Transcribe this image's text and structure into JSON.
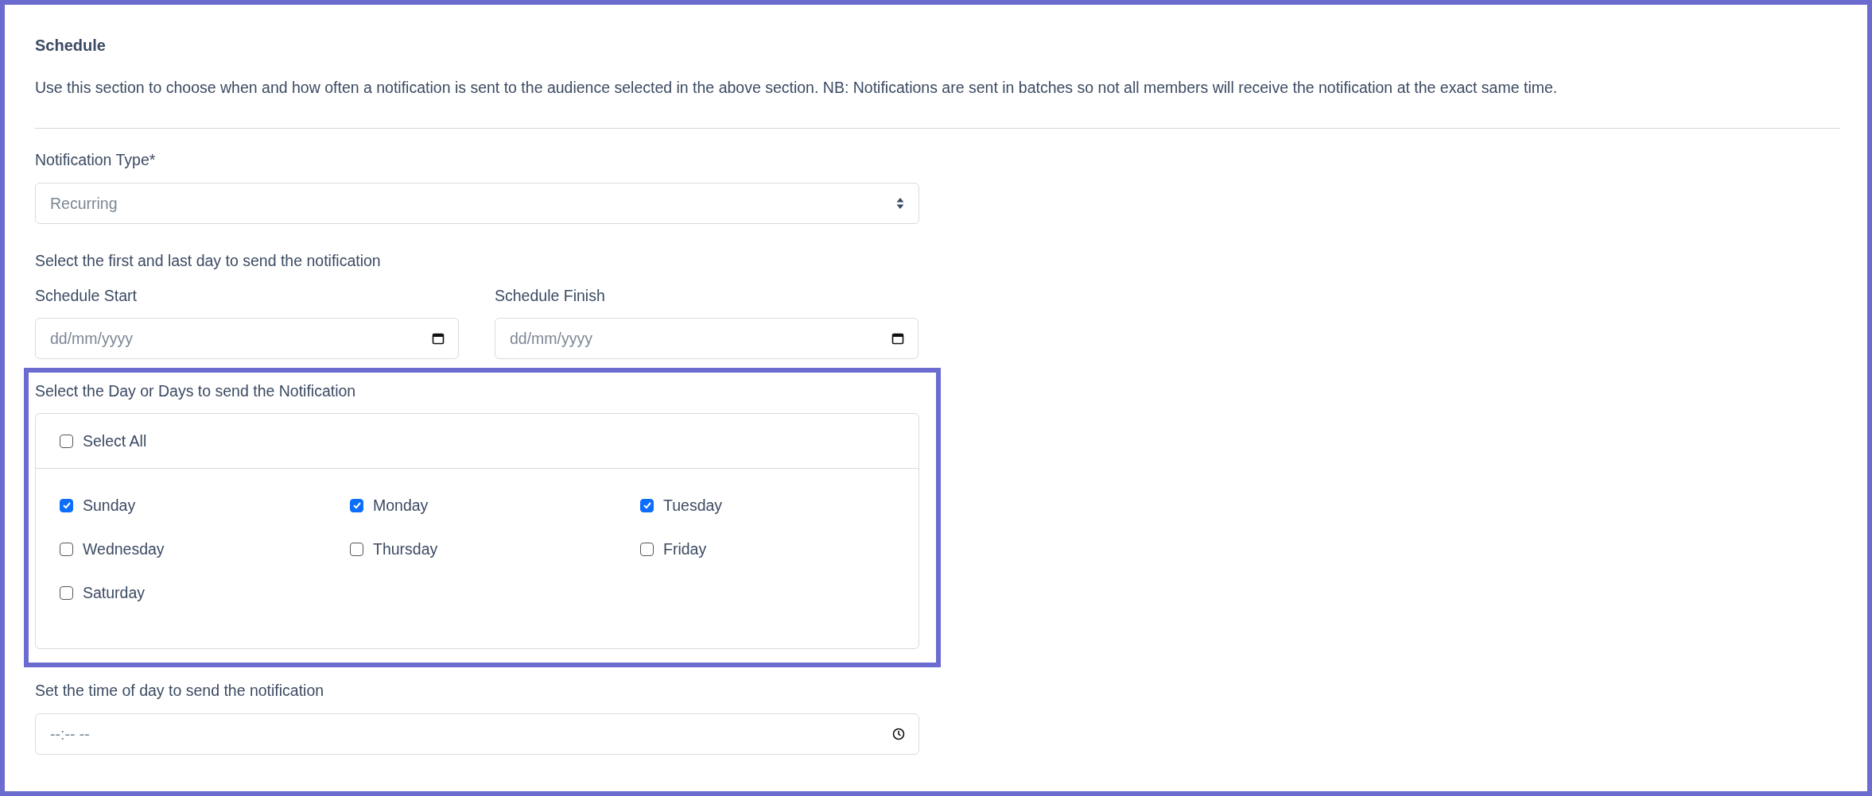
{
  "section": {
    "title": "Schedule",
    "description": "Use this section to choose when and how often a notification is sent to the audience selected in the above section. NB: Notifications are sent in batches so not all members will receive the notification at the exact same time."
  },
  "notification_type": {
    "label": "Notification Type*",
    "value": "Recurring"
  },
  "date_range": {
    "label": "Select the first and last day to send the notification",
    "start": {
      "label": "Schedule Start",
      "placeholder": "dd/mm/yyyy"
    },
    "finish": {
      "label": "Schedule Finish",
      "placeholder": "dd/mm/yyyy"
    }
  },
  "days": {
    "label": "Select the Day or Days to send the Notification",
    "highlighted": true,
    "select_all": {
      "label": "Select All",
      "checked": false
    },
    "items": [
      {
        "label": "Sunday",
        "checked": true
      },
      {
        "label": "Monday",
        "checked": true
      },
      {
        "label": "Tuesday",
        "checked": true
      },
      {
        "label": "Wednesday",
        "checked": false
      },
      {
        "label": "Thursday",
        "checked": false
      },
      {
        "label": "Friday",
        "checked": false
      },
      {
        "label": "Saturday",
        "checked": false
      }
    ]
  },
  "time": {
    "label": "Set the time of day to send the notification",
    "placeholder": "--:-- --"
  }
}
